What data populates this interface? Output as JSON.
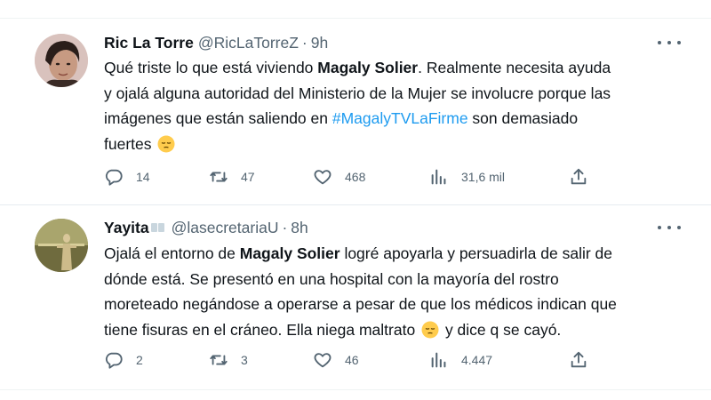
{
  "tweets": [
    {
      "author_name": "Ric La Torre",
      "handle": "@RicLaTorreZ",
      "separator": "·",
      "time": "9h",
      "text_line1_a": "Qué triste lo que está viviendo ",
      "text_line1_bold": "Magaly Solier",
      "text_line1_b": ". Realmente necesita ayuda",
      "text_line2": "y ojalá alguna autoridad del Ministerio de la Mujer se involucre porque las",
      "text_line3_a": "imágenes que están saliendo en ",
      "text_line3_hashtag": "#MagalyTVLaFirme",
      "text_line3_b": " son demasiado",
      "text_line4": "fuertes",
      "replies": "14",
      "retweets": "47",
      "likes": "468",
      "views": "31,6 mil"
    },
    {
      "author_name": "Yayita",
      "handle": "@lasecretariaU",
      "separator": "·",
      "time": "8h",
      "text_line1_a": "Ojalá el entorno de ",
      "text_line1_bold": "Magaly Solier",
      "text_line1_b": " logré apoyarla y persuadirla de salir de",
      "text_line2": "dónde está. Se presentó en una hospital con la mayoría del rostro",
      "text_line3": "moreteado negándose a operarse a pesar de que los médicos indican que",
      "text_line4_a": "tiene fisuras en el cráneo. Ella niega maltrato",
      "text_line4_b": " y dice q se cayó.",
      "replies": "2",
      "retweets": "3",
      "likes": "46",
      "views": "4.447"
    }
  ],
  "icons": {
    "reply": "reply-icon",
    "retweet": "retweet-icon",
    "like": "heart-icon",
    "views": "views-icon",
    "share": "share-icon",
    "more": "more-icon",
    "emoji": "pensive-face-emoji"
  },
  "colors": {
    "hashtag": "#1d9bf0",
    "secondary_text": "#536471",
    "primary_text": "#0f1419"
  }
}
